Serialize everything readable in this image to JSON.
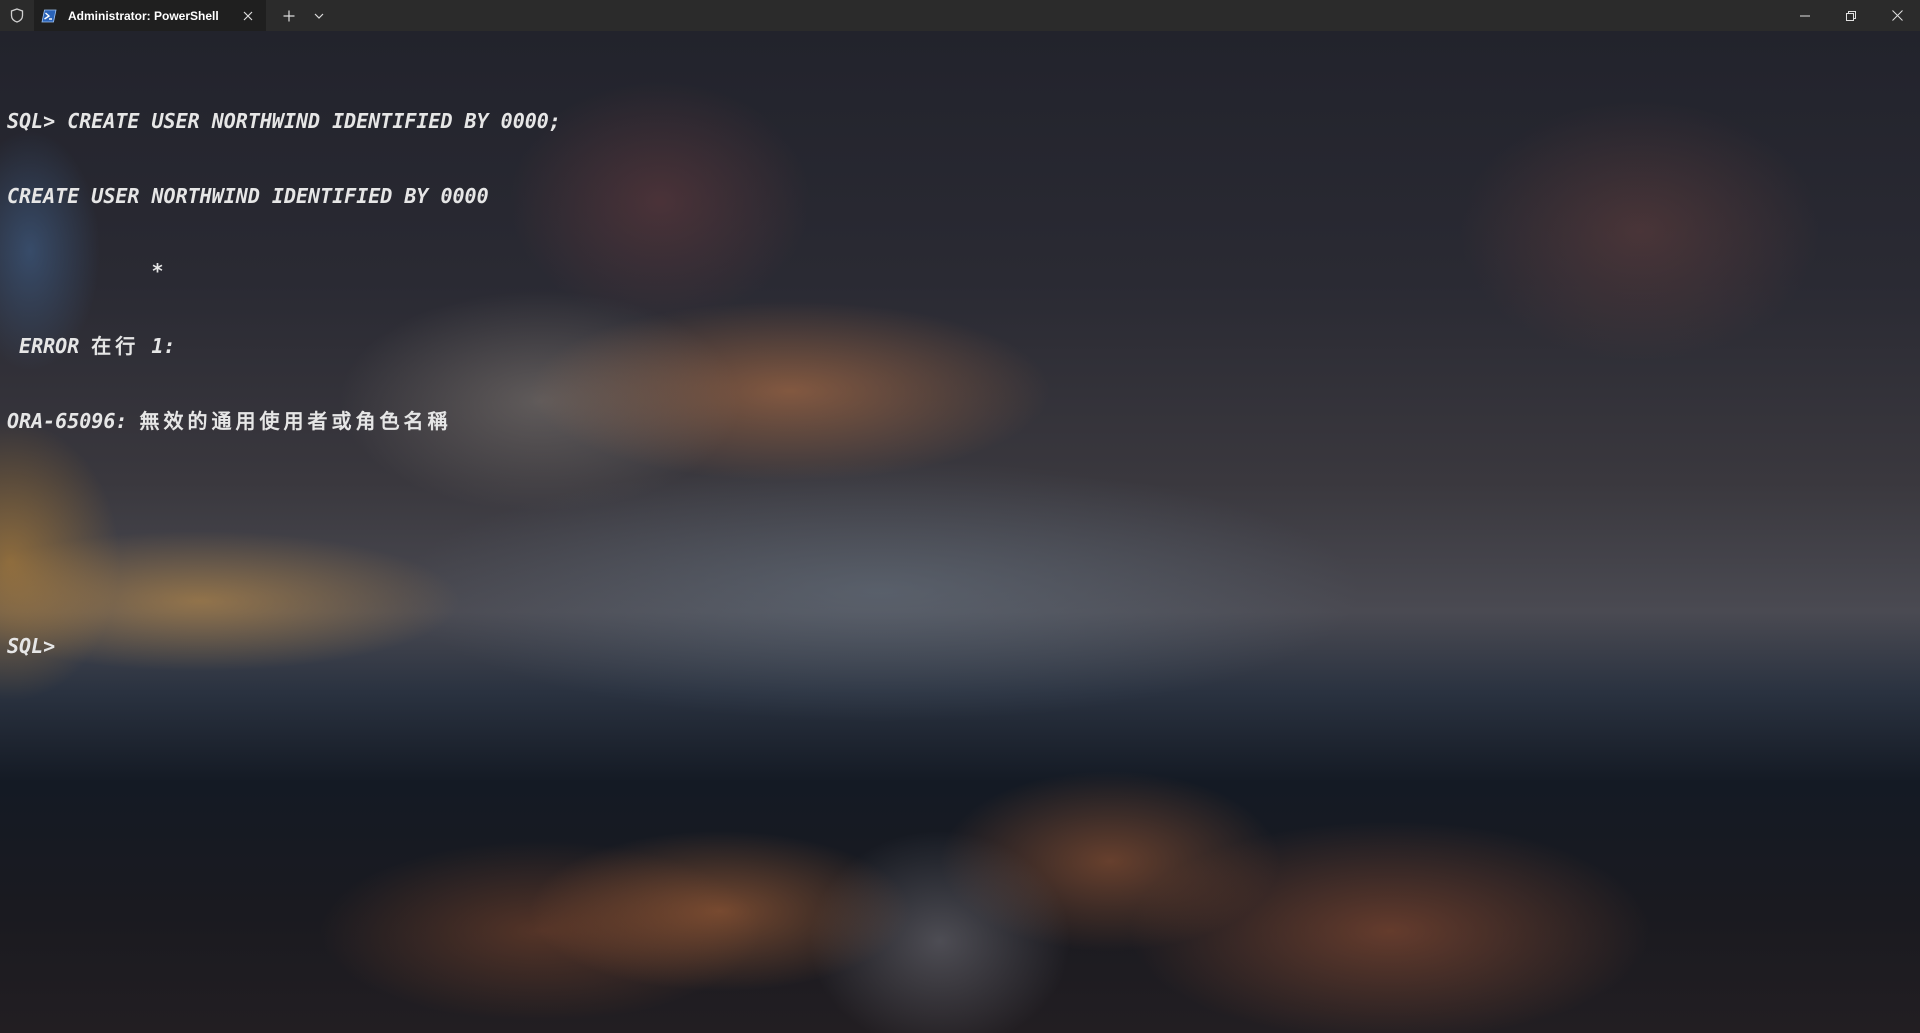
{
  "window": {
    "tab_title": "Administrator: PowerShell",
    "icons": {
      "admin": "shield-icon",
      "tab": "powershell-icon",
      "close_tab": "close-icon",
      "new_tab": "plus-icon",
      "dropdown": "chevron-down-icon",
      "minimize": "minimize-icon",
      "maximize": "restore-icon",
      "close": "close-icon"
    }
  },
  "terminal": {
    "lines": [
      "SQL> CREATE USER NORTHWIND IDENTIFIED BY 0000;",
      "CREATE USER NORTHWIND IDENTIFIED BY 0000",
      "            *",
      " ERROR ",
      "ORA-65096: ",
      "",
      "",
      "SQL>"
    ],
    "error_location_cjk": "在行",
    "error_location_num": " 1:",
    "error_message_cjk": "無效的通用使用者或角色名稱"
  },
  "colors": {
    "titlebar_bg": "#2b2b2b",
    "tab_active_bg": "#1f1f1f",
    "text": "#e6e6e6"
  }
}
